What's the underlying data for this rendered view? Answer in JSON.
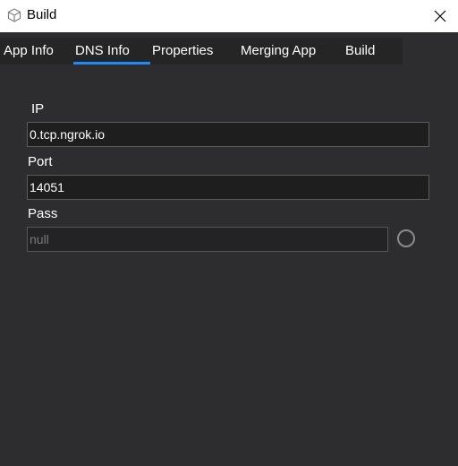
{
  "window": {
    "title": "Build",
    "app_icon": "cube-icon",
    "close_icon": "close-icon"
  },
  "tabs": [
    {
      "label": "App Info",
      "active": false
    },
    {
      "label": "DNS Info",
      "active": true
    },
    {
      "label": "Properties",
      "active": false
    },
    {
      "label": "Merging App",
      "active": false
    },
    {
      "label": "Build",
      "active": false
    }
  ],
  "form": {
    "ip": {
      "label": "IP",
      "value": "0.tcp.ngrok.io"
    },
    "port": {
      "label": "Port",
      "value": "14051"
    },
    "pass": {
      "label": "Pass",
      "value": "null",
      "enabled": false,
      "radio_checked": false
    }
  },
  "colors": {
    "background": "#2d2d30",
    "titlebar": "#ffffff",
    "accent": "#1a8cff",
    "field_border": "#5a5a5a"
  }
}
